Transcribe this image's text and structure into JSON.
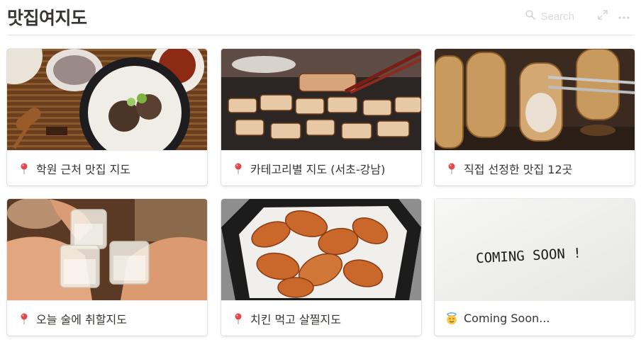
{
  "page": {
    "title": "맛집여지도"
  },
  "toolbar": {
    "search_label": "Search",
    "search_icon": "search-icon",
    "expand_icon": "expand-icon",
    "more_icon": "more-icon"
  },
  "cards": [
    {
      "title": "학원 근처 맛집 지도",
      "icon": "round-pushpin-icon",
      "image": "gukbap-soup-photo"
    },
    {
      "title": "카테고리별 지도 (서초-강남)",
      "icon": "round-pushpin-icon",
      "image": "grilled-pork-belly-photo"
    },
    {
      "title": "직접 선정한 맛집 12곳",
      "icon": "round-pushpin-icon",
      "image": "grilled-pork-close-up-photo"
    },
    {
      "title": "오늘 술에 취할지도",
      "icon": "round-pushpin-icon",
      "image": "soju-toast-photo"
    },
    {
      "title": "치킨 먹고 살찔지도",
      "icon": "round-pushpin-icon",
      "image": "fried-chicken-photo"
    },
    {
      "title": "Coming Soon...",
      "icon": "smiling-face-with-halo-icon",
      "image": "coming-soon-card-photo",
      "image_text": "COMING SOON !"
    }
  ],
  "colors": {
    "pin_red": "#e0484b",
    "pin_white": "#f4f4f4",
    "halo_yellow": "#f7c948",
    "divider": "#e3e2df"
  }
}
